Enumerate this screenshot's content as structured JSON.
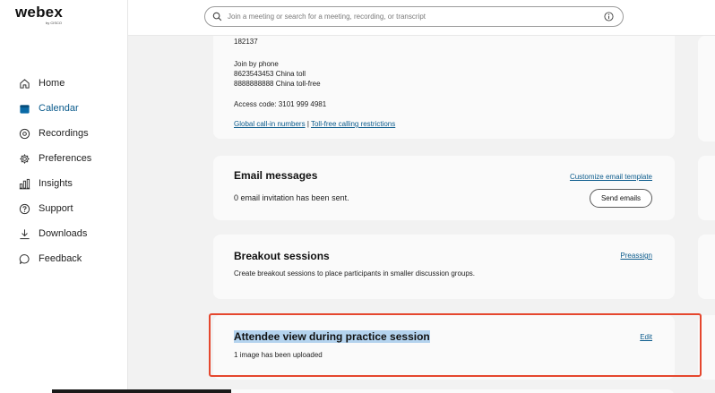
{
  "brand": {
    "logo_text": "webex",
    "logo_sub": "by CISCO"
  },
  "search": {
    "placeholder": "Join a meeting or search for a meeting, recording, or transcript"
  },
  "sidebar": {
    "items": [
      {
        "label": "Home",
        "icon": "home-icon"
      },
      {
        "label": "Calendar",
        "icon": "calendar-icon",
        "active": true
      },
      {
        "label": "Recordings",
        "icon": "recordings-icon"
      },
      {
        "label": "Preferences",
        "icon": "gear-icon"
      },
      {
        "label": "Insights",
        "icon": "insights-icon"
      },
      {
        "label": "Support",
        "icon": "help-icon"
      },
      {
        "label": "Downloads",
        "icon": "download-icon"
      },
      {
        "label": "Feedback",
        "icon": "feedback-icon"
      }
    ]
  },
  "meeting_info": {
    "number": "182137",
    "join_by_phone_label": "Join by phone",
    "phone_toll": "8623543453 China toll",
    "phone_tollfree": "8888888888 China toll-free",
    "access_code": "Access code: 3101 999 4981",
    "global_numbers_link": "Global call-in numbers",
    "separator": " | ",
    "tollfree_restrictions_link": "Toll-free calling restrictions"
  },
  "email_card": {
    "title": "Email messages",
    "status": "0 email invitation has been sent.",
    "customize_link": "Customize email template",
    "send_button": "Send emails"
  },
  "breakout_card": {
    "title": "Breakout sessions",
    "description": "Create breakout sessions to place participants in smaller discussion groups.",
    "preassign_link": "Preassign"
  },
  "attendee_card": {
    "title": "Attendee view during practice session",
    "status": "1 image has been uploaded",
    "edit_link": "Edit"
  },
  "colors": {
    "accent": "#0b5b8c",
    "highlight_frame": "#e5472e",
    "selection": "#b4d3ee",
    "calendar_icon": "#0a6aa6"
  }
}
